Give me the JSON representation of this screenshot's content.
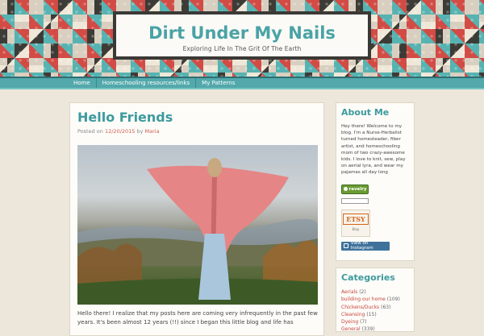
{
  "header": {
    "site_title": "Dirt Under My Nails",
    "tagline": "Exploring Life In The Grit Of The Earth"
  },
  "nav": {
    "items": [
      {
        "label": "Home"
      },
      {
        "label": "Homeschooling resources/links"
      },
      {
        "label": "My Patterns"
      }
    ]
  },
  "post": {
    "title": "Hello Friends",
    "meta_prefix": "Posted on ",
    "date": "12/20/2015",
    "meta_by": " by ",
    "author": "Maria",
    "body": "Hello there!  I realize that my posts here are coming very infrequently in the past few years.  It's been almost 12 years (!!) since I began this little blog and life has"
  },
  "sidebar": {
    "about": {
      "title": "About Me",
      "text": "Hey there! Welcome to my blog. I'm a Nurse-Herbalist turned homesteader, fiber artist, and homeschooling mom of two crazy-awesome kids. I love to knit, sew, play on aerial lyra, and wear my pajamas all day long",
      "ravelry_label": "ravelry",
      "etsy_label": "ETSY",
      "etsy_sub": "Etsy",
      "instagram_label": "View on Instagram"
    },
    "categories": {
      "title": "Categories",
      "items": [
        {
          "name": "Aerials",
          "count": "(2)"
        },
        {
          "name": "building our home",
          "count": "(109)"
        },
        {
          "name": "Chickens/Ducks",
          "count": "(63)"
        },
        {
          "name": "Cleansing",
          "count": "(15)"
        },
        {
          "name": "Dyeing",
          "count": "(7)"
        },
        {
          "name": "General",
          "count": "(339)"
        }
      ]
    }
  },
  "colors": {
    "accent_teal": "#4aa3a6",
    "link_red": "#c7443c",
    "nav_bg": "#52a8ab"
  }
}
